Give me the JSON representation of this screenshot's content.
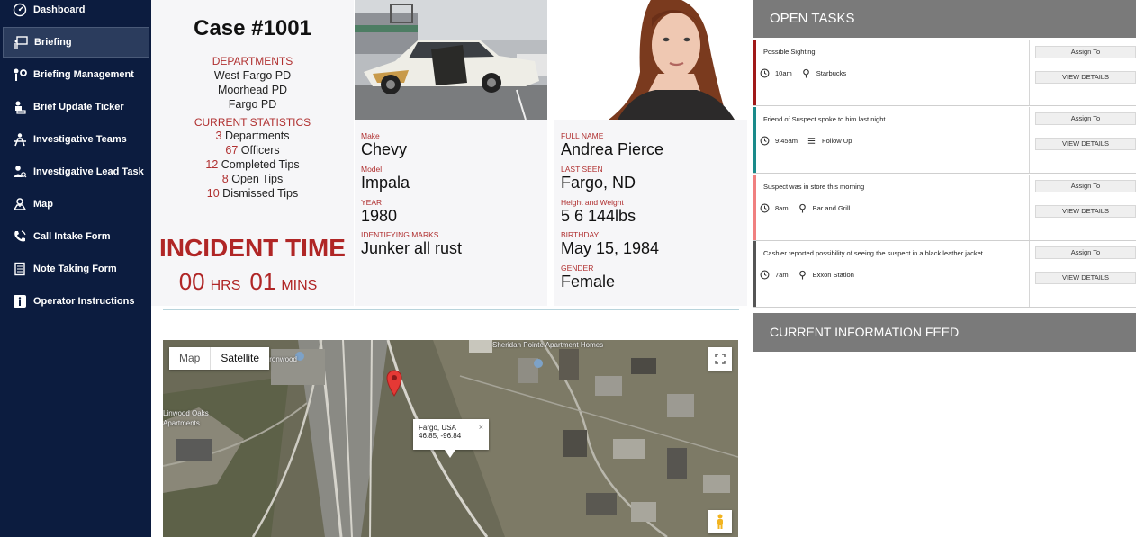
{
  "sidebar": {
    "items": [
      {
        "label": "Dashboard",
        "icon": "dashboard-icon"
      },
      {
        "label": "Briefing",
        "icon": "presentation-icon",
        "active": true
      },
      {
        "label": "Briefing Management",
        "icon": "management-icon"
      },
      {
        "label": "Brief Update Ticker",
        "icon": "ticker-icon"
      },
      {
        "label": "Investigative Teams",
        "icon": "teams-icon"
      },
      {
        "label": "Investigative Lead Task",
        "icon": "lead-task-icon"
      },
      {
        "label": "Map",
        "icon": "map-icon"
      },
      {
        "label": "Call Intake Form",
        "icon": "phone-icon"
      },
      {
        "label": "Note Taking Form",
        "icon": "note-icon"
      },
      {
        "label": "Operator Instructions",
        "icon": "info-icon"
      }
    ]
  },
  "case": {
    "title": "Case #1001",
    "departments_label": "DEPARTMENTS",
    "departments": [
      "West Fargo PD",
      "Moorhead PD",
      "Fargo PD"
    ],
    "stats_label": "CURRENT STATISTICS",
    "stats": [
      {
        "value": "3",
        "label": "Departments"
      },
      {
        "value": "67",
        "label": "Officers"
      },
      {
        "value": "12",
        "label": "Completed Tips"
      },
      {
        "value": "8",
        "label": "Open Tips"
      },
      {
        "value": "10",
        "label": "Dismissed Tips"
      }
    ],
    "incident_title": "INCIDENT TIME",
    "hours": "00",
    "hours_unit": "HRS",
    "minutes": "01",
    "minutes_unit": "MINS"
  },
  "vehicle": {
    "fields": [
      {
        "label": "Make",
        "value": "Chevy"
      },
      {
        "label": "Model",
        "value": "Impala"
      },
      {
        "label": "YEAR",
        "value": "1980"
      },
      {
        "label": "IDENTIFYING MARKS",
        "value": "Junker all rust"
      }
    ]
  },
  "suspect": {
    "fields": [
      {
        "label": "FULL NAME",
        "value": "Andrea Pierce"
      },
      {
        "label": "LAST SEEN",
        "value": "Fargo, ND"
      },
      {
        "label": "Height and Weight",
        "value": "5 6 144lbs"
      },
      {
        "label": "BIRTHDAY",
        "value": "May 15, 1984"
      },
      {
        "label": "GENDER",
        "value": "Female"
      }
    ]
  },
  "map": {
    "type_map": "Map",
    "type_satellite": "Satellite",
    "info_title": "Fargo, USA",
    "info_coords": "46.85, -96.84",
    "close_glyph": "×",
    "labels": [
      "Sheridan Pointe Apartment Homes",
      "Linwood Oaks",
      "Apartments",
      "Ironwood"
    ]
  },
  "tasks": {
    "header": "OPEN TASKS",
    "assign_label": "Assign To",
    "details_label": "VIEW DETAILS",
    "items": [
      {
        "description": "Possible Sighting",
        "time": "10am",
        "place": "Starbucks",
        "place_icon": "pin-icon",
        "color": "#a01818"
      },
      {
        "description": "Friend of Suspect spoke to him last night",
        "time": "9:45am",
        "place": "Follow Up",
        "place_icon": "list-icon",
        "color": "#1a8a8a"
      },
      {
        "description": "Suspect was in store this morning",
        "time": "8am",
        "place": "Bar and Grill",
        "place_icon": "pin-icon",
        "color": "#f08080"
      },
      {
        "description": "Cashier reported possibility of seeing the suspect in a black leather jacket.",
        "time": "7am",
        "place": "Exxon Station",
        "place_icon": "pin-icon",
        "color": "#555555"
      }
    ]
  },
  "feed": {
    "header": "CURRENT INFORMATION FEED"
  }
}
